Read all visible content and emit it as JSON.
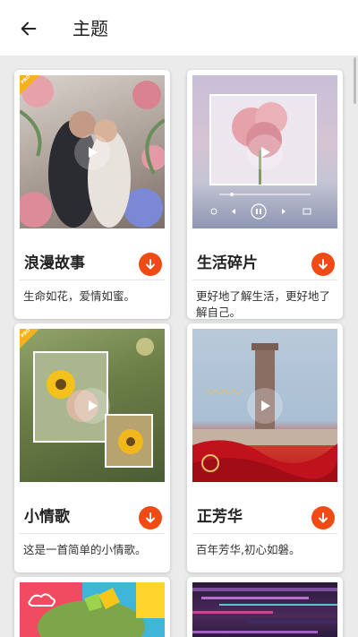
{
  "appbar": {
    "title": "主题"
  },
  "themes": [
    {
      "title": "浪漫故事",
      "desc": "生命如花，爱情如蜜。",
      "pro": true
    },
    {
      "title": "生活碎片",
      "desc": "更好地了解生活，更好地了解自己。",
      "pro": false
    },
    {
      "title": "小情歌",
      "desc": "这是一首简单的小情歌。",
      "pro": true
    },
    {
      "title": "正芳华",
      "desc": "百年芳华,初心如磐。",
      "pro": false
    }
  ],
  "pro_label": "PRO",
  "colors": {
    "accent": "#f24a15",
    "pro_badge": "#f6b21c"
  }
}
